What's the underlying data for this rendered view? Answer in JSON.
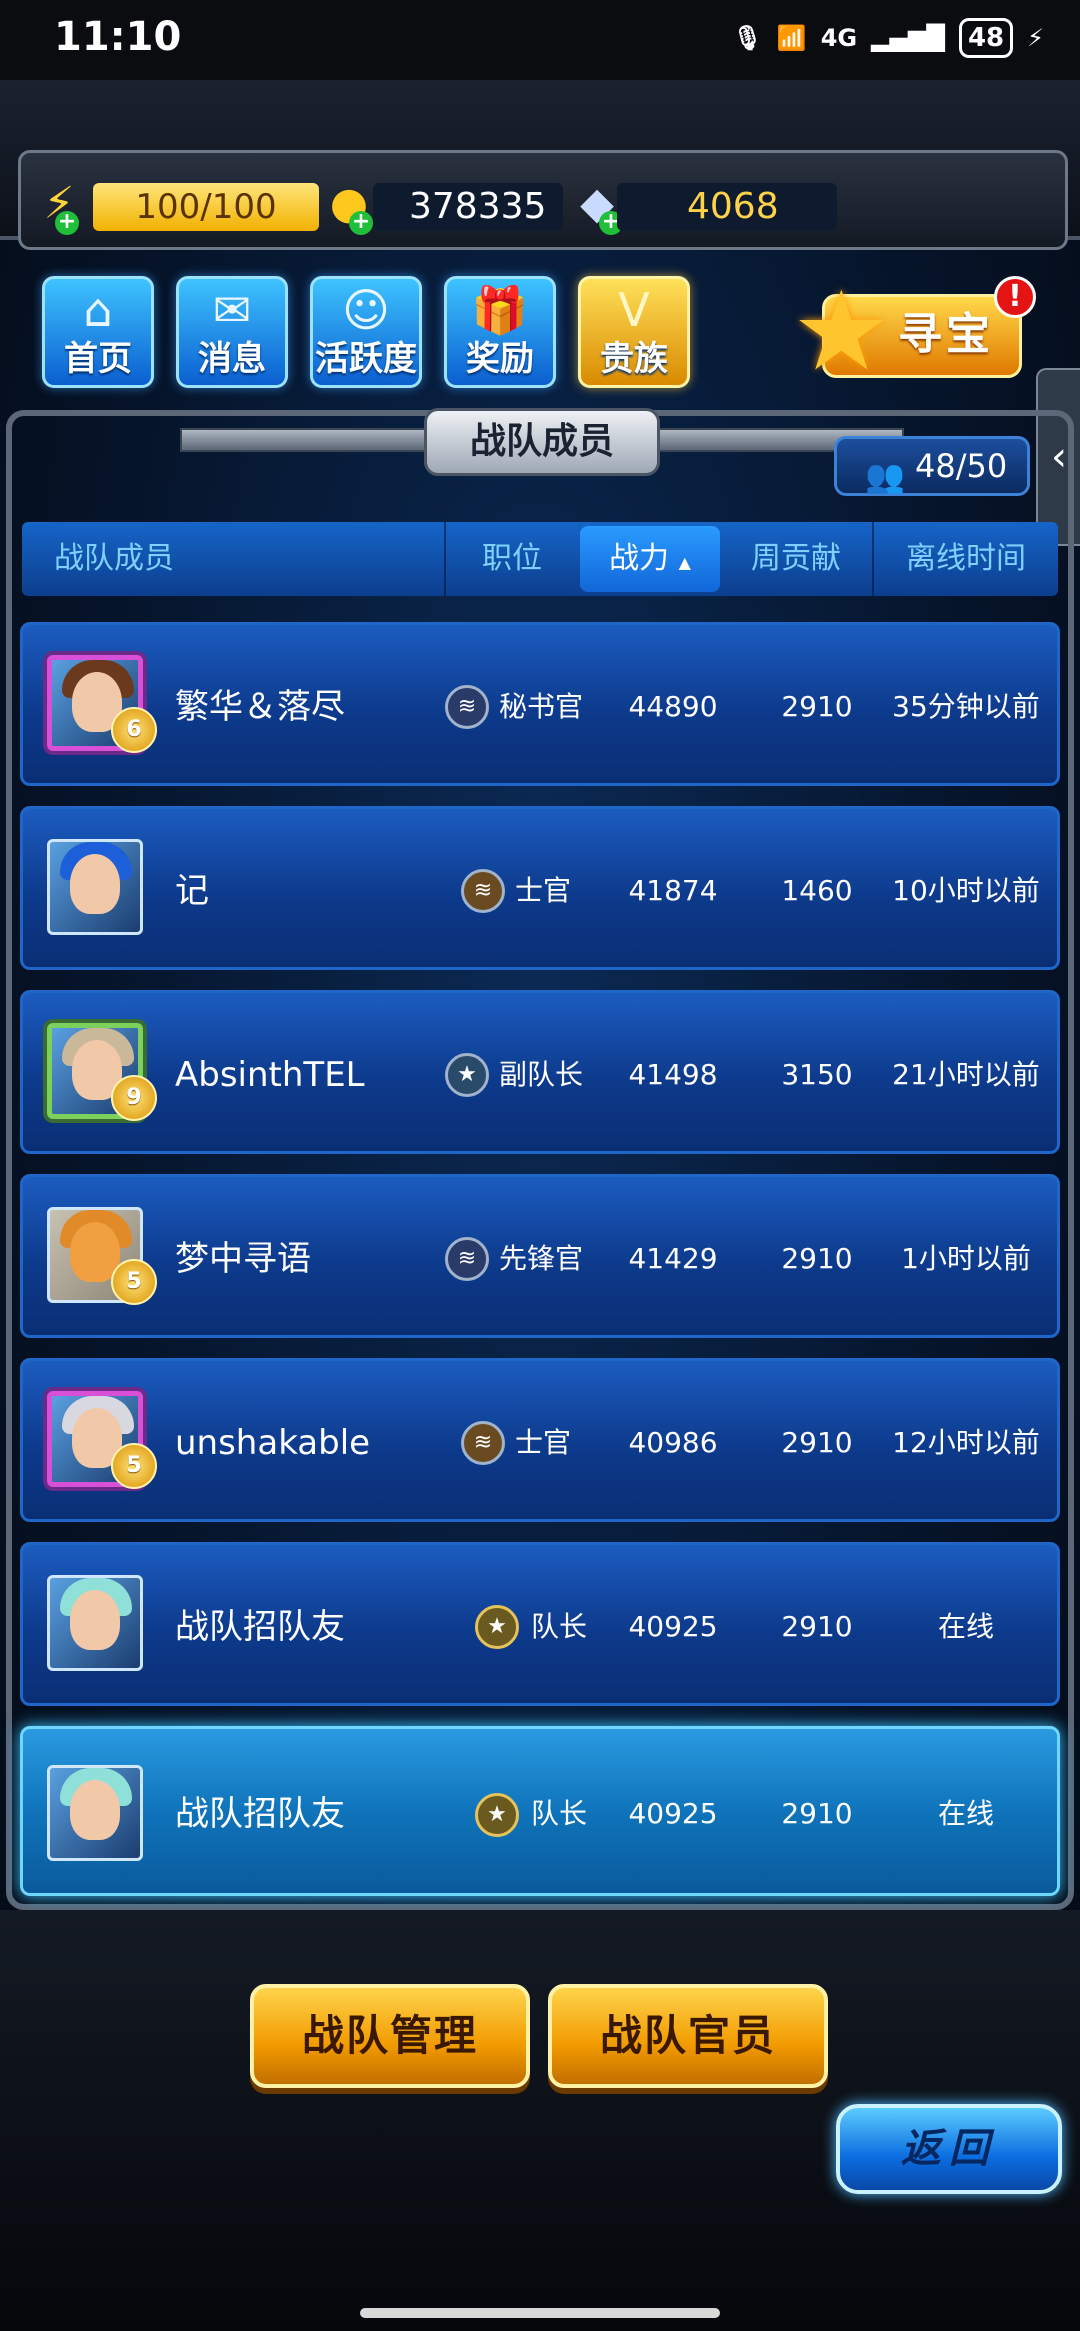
{
  "status_bar": {
    "time": "11:10",
    "network": "4G",
    "battery": "48"
  },
  "resources": {
    "energy": "100/100",
    "coins": "378335",
    "gems": "4068"
  },
  "nav": {
    "items": [
      {
        "label": "首页"
      },
      {
        "label": "消息"
      },
      {
        "label": "活跃度"
      },
      {
        "label": "奖励"
      },
      {
        "label": "贵族"
      }
    ],
    "treasure": "寻宝",
    "alert": "!"
  },
  "panel": {
    "title": "战队成员",
    "member_count": "48/50"
  },
  "table": {
    "headers": [
      "战队成员",
      "职位",
      "战力",
      "周贡献",
      "离线时间"
    ],
    "sorted_indicator": "▲",
    "rows": [
      {
        "name": "繁华＆落尽",
        "role": "秘书官",
        "power": "44890",
        "weekly": "2910",
        "offline": "35分钟以前",
        "vip": "6"
      },
      {
        "name": "记",
        "role": "士官",
        "power": "41874",
        "weekly": "1460",
        "offline": "10小时以前",
        "vip": ""
      },
      {
        "name": "AbsinthTEL",
        "role": "副队长",
        "power": "41498",
        "weekly": "3150",
        "offline": "21小时以前",
        "vip": "9"
      },
      {
        "name": "梦中寻语",
        "role": "先锋官",
        "power": "41429",
        "weekly": "2910",
        "offline": "1小时以前",
        "vip": "5"
      },
      {
        "name": "unshakable",
        "role": "士官",
        "power": "40986",
        "weekly": "2910",
        "offline": "12小时以前",
        "vip": "5"
      },
      {
        "name": "战队招队友",
        "role": "队长",
        "power": "40925",
        "weekly": "2910",
        "offline": "在线",
        "vip": ""
      },
      {
        "name": "战队招队友",
        "role": "队长",
        "power": "40925",
        "weekly": "2910",
        "offline": "在线",
        "vip": ""
      }
    ]
  },
  "buttons": {
    "manage": "战队管理",
    "officers": "战队官员",
    "back": "返回"
  },
  "colors": {
    "row_bg": "#0d3a8c",
    "row_highlight": "#0f74bb",
    "gold_button": "#f19a00",
    "blue_button": "#0b6de0"
  }
}
